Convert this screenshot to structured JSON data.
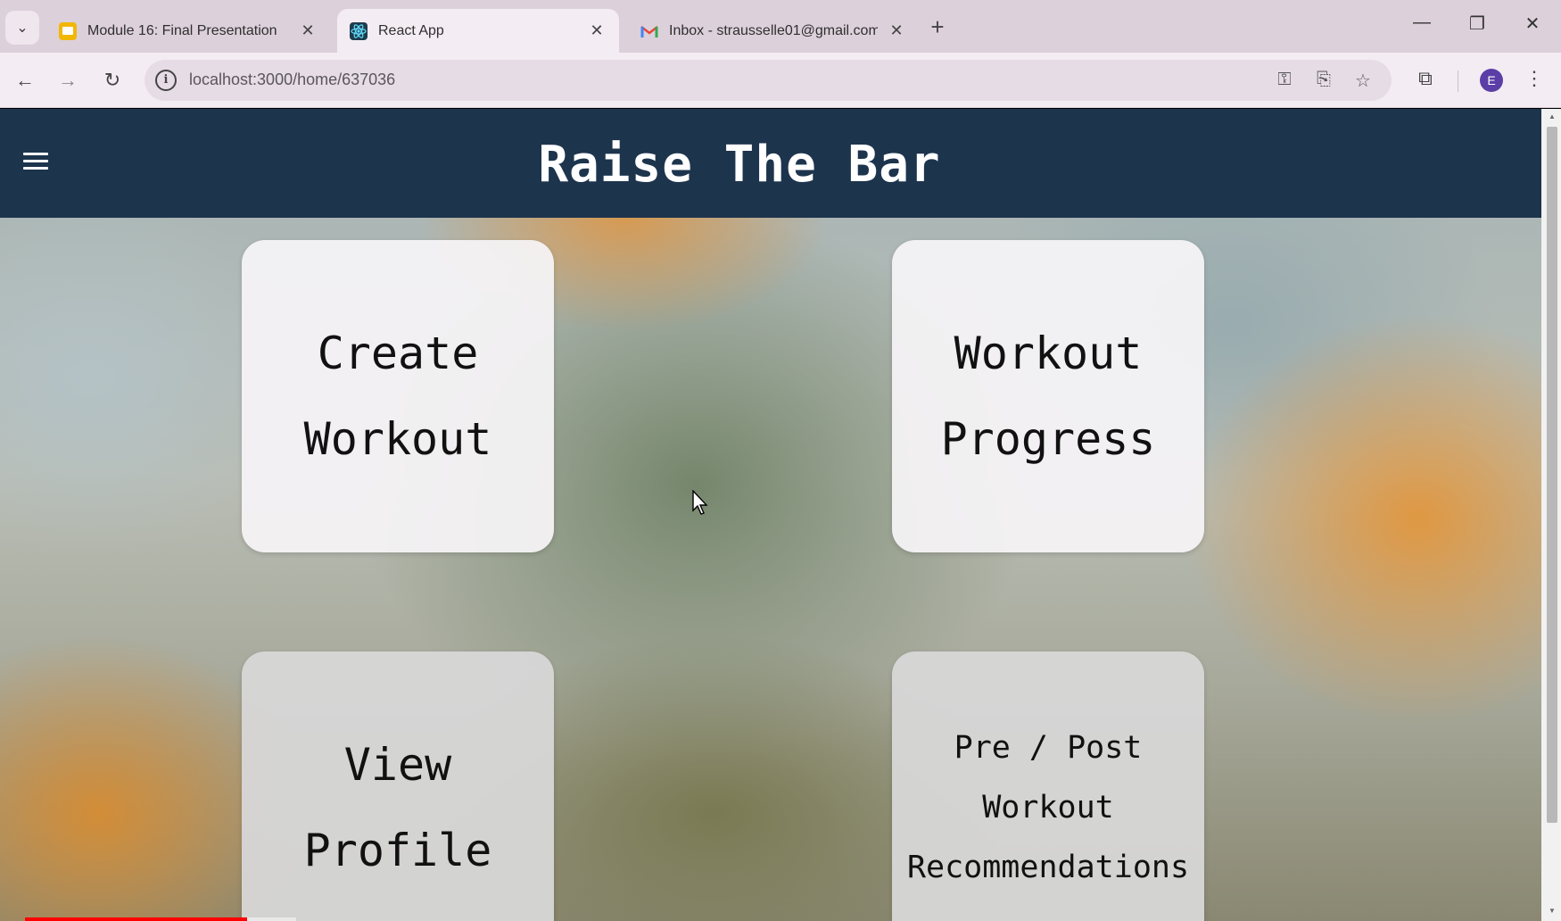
{
  "browser": {
    "tabs": [
      {
        "title": "Module 16: Final Presentation",
        "favicon": "slides-icon",
        "active": false
      },
      {
        "title": "React App",
        "favicon": "react-icon",
        "active": true
      },
      {
        "title": "Inbox - strausselle01@gmail.com",
        "favicon": "gmail-icon",
        "active": false
      }
    ],
    "url": "localhost:3000/home/637036",
    "profile_initial": "E",
    "colors": {
      "tabstrip": "#dcd0da",
      "toolbar": "#f4ecf3",
      "avatar": "#5b3fa6"
    }
  },
  "app": {
    "title": "Raise The Bar",
    "header_color": "#1d344d",
    "cards": {
      "create_workout": [
        "Create",
        "Workout"
      ],
      "workout_progress": [
        "Workout",
        "Progress"
      ],
      "view_profile": [
        "View",
        "Profile"
      ],
      "recommendations": [
        "Pre / Post",
        "Workout",
        "Recommendations"
      ]
    }
  },
  "video": {
    "progress_fraction": 0.15
  }
}
